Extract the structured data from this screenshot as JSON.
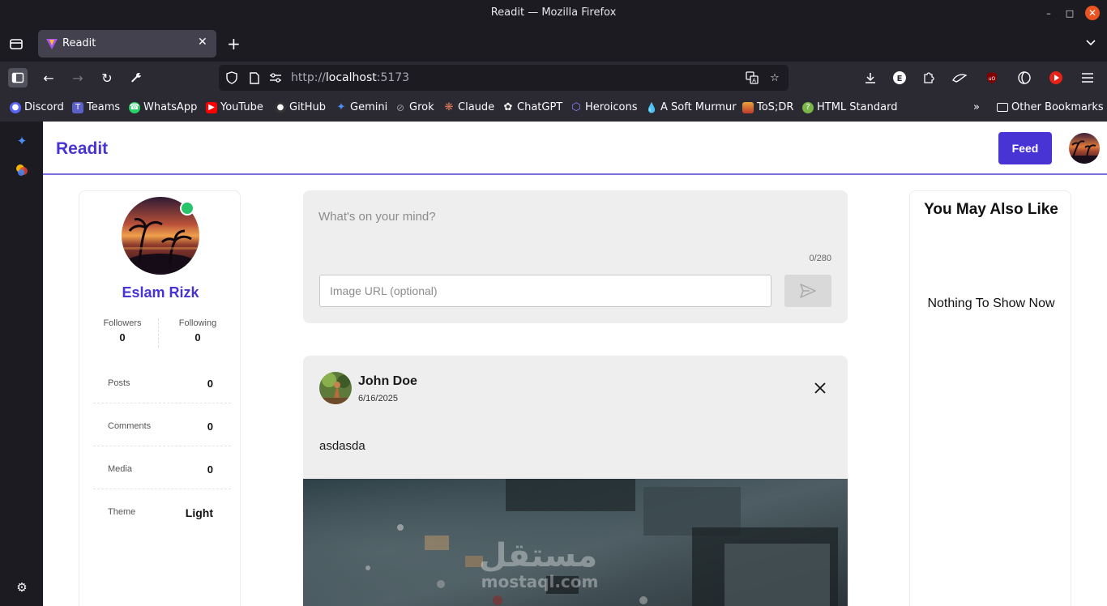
{
  "window": {
    "title": "Readit — Mozilla Firefox"
  },
  "tabs": [
    {
      "label": "Readit"
    }
  ],
  "urlbar": {
    "scheme": "http://",
    "host": "localhost",
    "port": ":5173"
  },
  "bookmarks": [
    {
      "label": "Discord",
      "icon": "discord-icon",
      "color": "#5865f2"
    },
    {
      "label": "Teams",
      "icon": "teams-icon",
      "color": "#5b5fc7"
    },
    {
      "label": "WhatsApp",
      "icon": "whatsapp-icon",
      "color": "#25d366"
    },
    {
      "label": "YouTube",
      "icon": "youtube-icon",
      "color": "#ff0000"
    },
    {
      "label": "GitHub",
      "icon": "github-icon",
      "color": "#333333"
    },
    {
      "label": "Gemini",
      "icon": "gemini-icon",
      "color": "#4c8df6"
    },
    {
      "label": "Grok",
      "icon": "grok-icon",
      "color": "#111111"
    },
    {
      "label": "Claude",
      "icon": "claude-icon",
      "color": "#d97757"
    },
    {
      "label": "ChatGPT",
      "icon": "chatgpt-icon",
      "color": "#444654"
    },
    {
      "label": "Heroicons",
      "icon": "heroicons-icon",
      "color": "#6b63ff"
    },
    {
      "label": "A Soft Murmur",
      "icon": "drop-icon",
      "color": "#4aa3df"
    },
    {
      "label": "ToS;DR",
      "icon": "tosdr-icon",
      "color": "#e8a33d"
    },
    {
      "label": "HTML Standard",
      "icon": "html-standard-icon",
      "color": "#7ab648"
    }
  ],
  "other_bookmarks": "Other Bookmarks",
  "app": {
    "brand": "Readit",
    "nav": {
      "feed_label": "Feed"
    },
    "accent": "#4834d4"
  },
  "profile": {
    "name": "Eslam Rizk",
    "followers_label": "Followers",
    "followers": "0",
    "following_label": "Following",
    "following": "0",
    "rows": [
      {
        "label": "Posts",
        "value": "0"
      },
      {
        "label": "Comments",
        "value": "0"
      },
      {
        "label": "Media",
        "value": "0"
      },
      {
        "label": "Theme",
        "value": "Light"
      }
    ],
    "online_color": "#27c46b"
  },
  "composer": {
    "placeholder": "What's on your mind?",
    "counter": "0/280",
    "image_placeholder": "Image URL (optional)"
  },
  "posts": [
    {
      "author": "John Doe",
      "date": "6/16/2025",
      "text": "asdasda",
      "watermark": "مستقل mostaql.com"
    }
  ],
  "suggestions": {
    "heading": "You May Also Like",
    "empty": "Nothing To Show Now"
  }
}
